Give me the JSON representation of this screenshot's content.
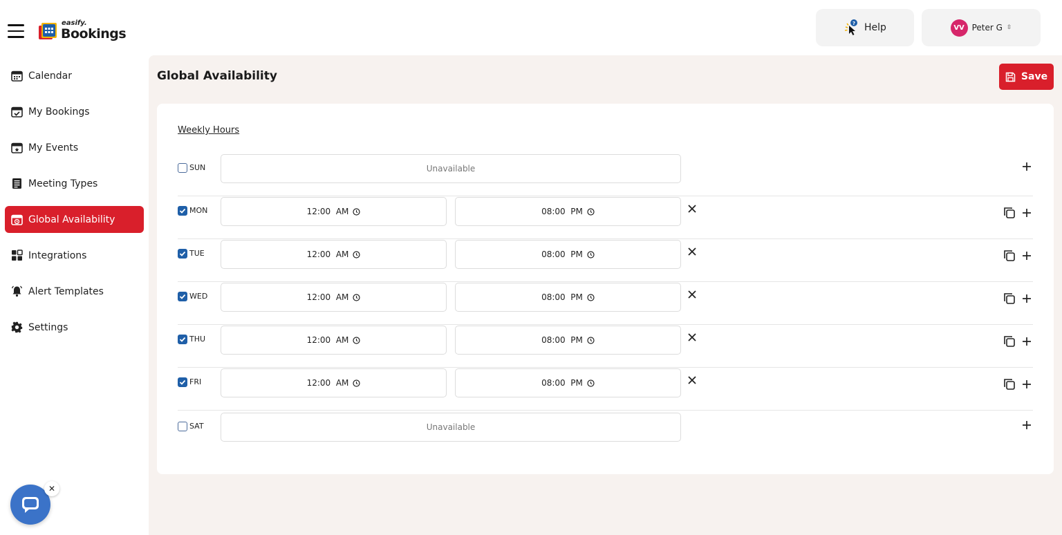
{
  "app": {
    "logo_small": "easify.",
    "logo_big": "Bookings"
  },
  "header": {
    "help_label": "Help",
    "user_initials": "VV",
    "user_name": "Peter G",
    "avatar_color": "#d6266a"
  },
  "sidebar": {
    "items": [
      {
        "label": "Calendar",
        "icon": "calendar-icon"
      },
      {
        "label": "My Bookings",
        "icon": "calendar-check-icon"
      },
      {
        "label": "My Events",
        "icon": "calendar-star-icon"
      },
      {
        "label": "Meeting Types",
        "icon": "list-icon"
      },
      {
        "label": "Global Availability",
        "icon": "calendar-clock-icon",
        "active": true
      },
      {
        "label": "Integrations",
        "icon": "grid-icon"
      },
      {
        "label": "Alert Templates",
        "icon": "bell-icon"
      },
      {
        "label": "Settings",
        "icon": "gear-icon"
      }
    ]
  },
  "main": {
    "title": "Global Availability",
    "save_label": "Save",
    "weekly_hours_label": "Weekly Hours",
    "unavailable_label": "Unavailable",
    "days": [
      {
        "label": "SUN",
        "checked": false,
        "start": "",
        "end": ""
      },
      {
        "label": "MON",
        "checked": true,
        "start": "12:00  AM",
        "end": "08:00  PM"
      },
      {
        "label": "TUE",
        "checked": true,
        "start": "12:00  AM",
        "end": "08:00  PM"
      },
      {
        "label": "WED",
        "checked": true,
        "start": "12:00  AM",
        "end": "08:00  PM"
      },
      {
        "label": "THU",
        "checked": true,
        "start": "12:00  AM",
        "end": "08:00  PM"
      },
      {
        "label": "FRI",
        "checked": true,
        "start": "12:00  AM",
        "end": "08:00  PM"
      },
      {
        "label": "SAT",
        "checked": false,
        "start": "",
        "end": ""
      }
    ]
  },
  "colors": {
    "accent": "#d91f2b",
    "checkbox": "#1f5fa8",
    "main_bg": "#f7f2ef",
    "chat": "#3b73c8"
  }
}
